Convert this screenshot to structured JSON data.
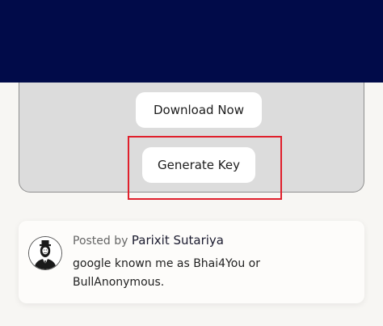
{
  "download": {
    "download_label": "Download Now",
    "generate_label": "Generate Key"
  },
  "author": {
    "posted_by_label": "Posted by",
    "name": "Parixit Sutariya",
    "bio": "google known me as Bhai4You or BullAnonymous."
  },
  "colors": {
    "header": "#010b49",
    "panel": "#dcdcdc",
    "highlight": "#e0202c",
    "page_background": "#f7f6f3"
  }
}
